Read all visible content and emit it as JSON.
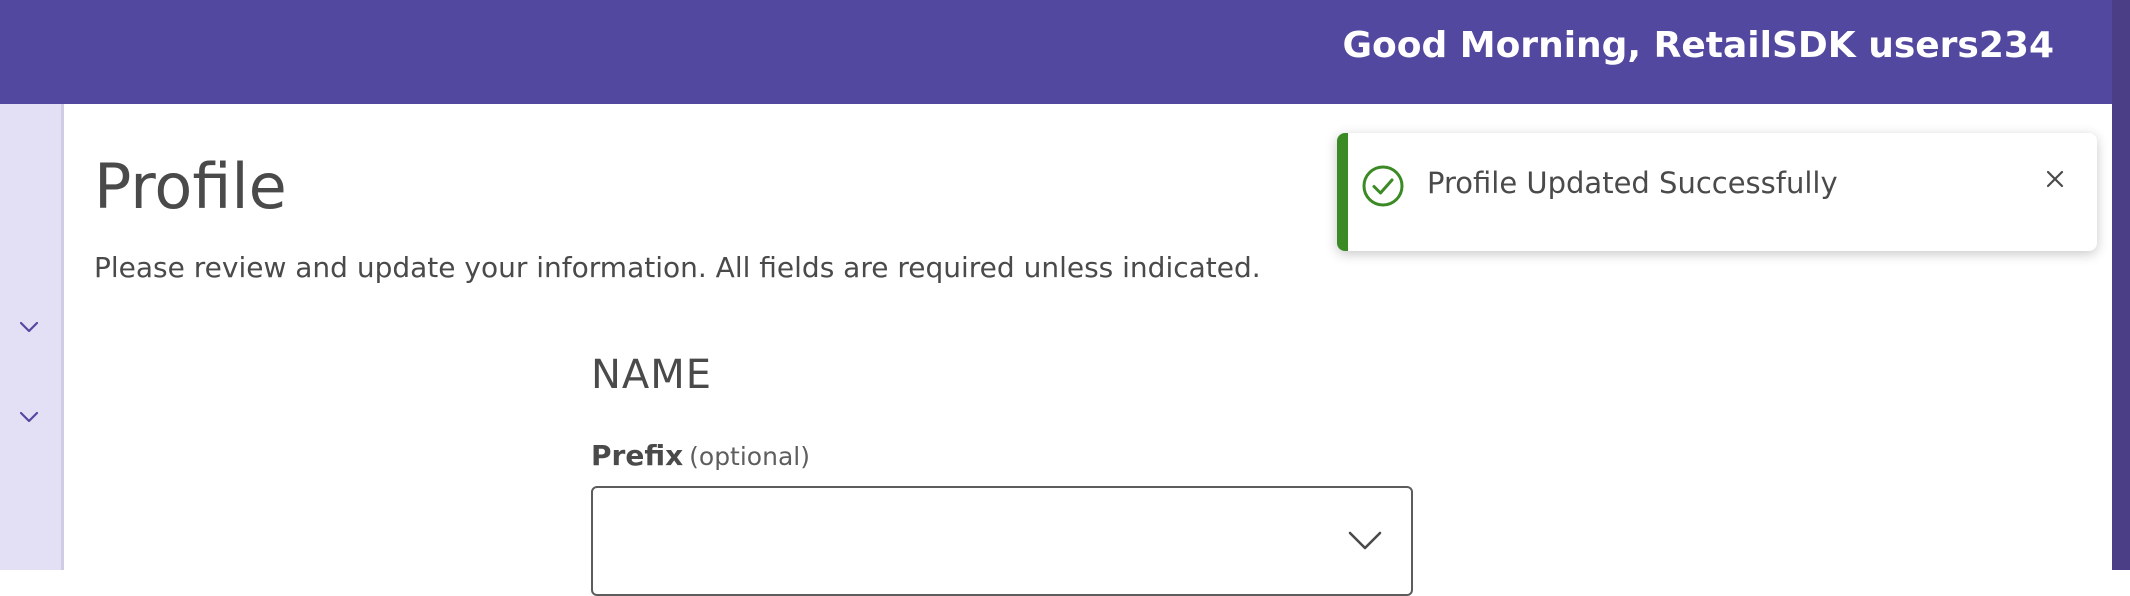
{
  "header": {
    "greeting": "Good Morning, RetailSDK users234",
    "background_color": "#5348a0"
  },
  "sidebar": {
    "background_color": "#e3e0f6",
    "icons": [
      "chevron-down-icon",
      "chevron-down-icon"
    ]
  },
  "main": {
    "title": "Profile",
    "subtitle": "Please review and update your information. All fields are required unless indicated.",
    "section": {
      "title": "NAME",
      "fields": {
        "prefix": {
          "label": "Prefix",
          "optional_label": "(optional)",
          "value": "",
          "icon": "chevron-down-icon"
        }
      }
    }
  },
  "toast": {
    "message": "Profile Updated Successfully",
    "accent_color": "#3b8a26",
    "icon": "check-circle-icon",
    "close_icon": "close-icon"
  }
}
